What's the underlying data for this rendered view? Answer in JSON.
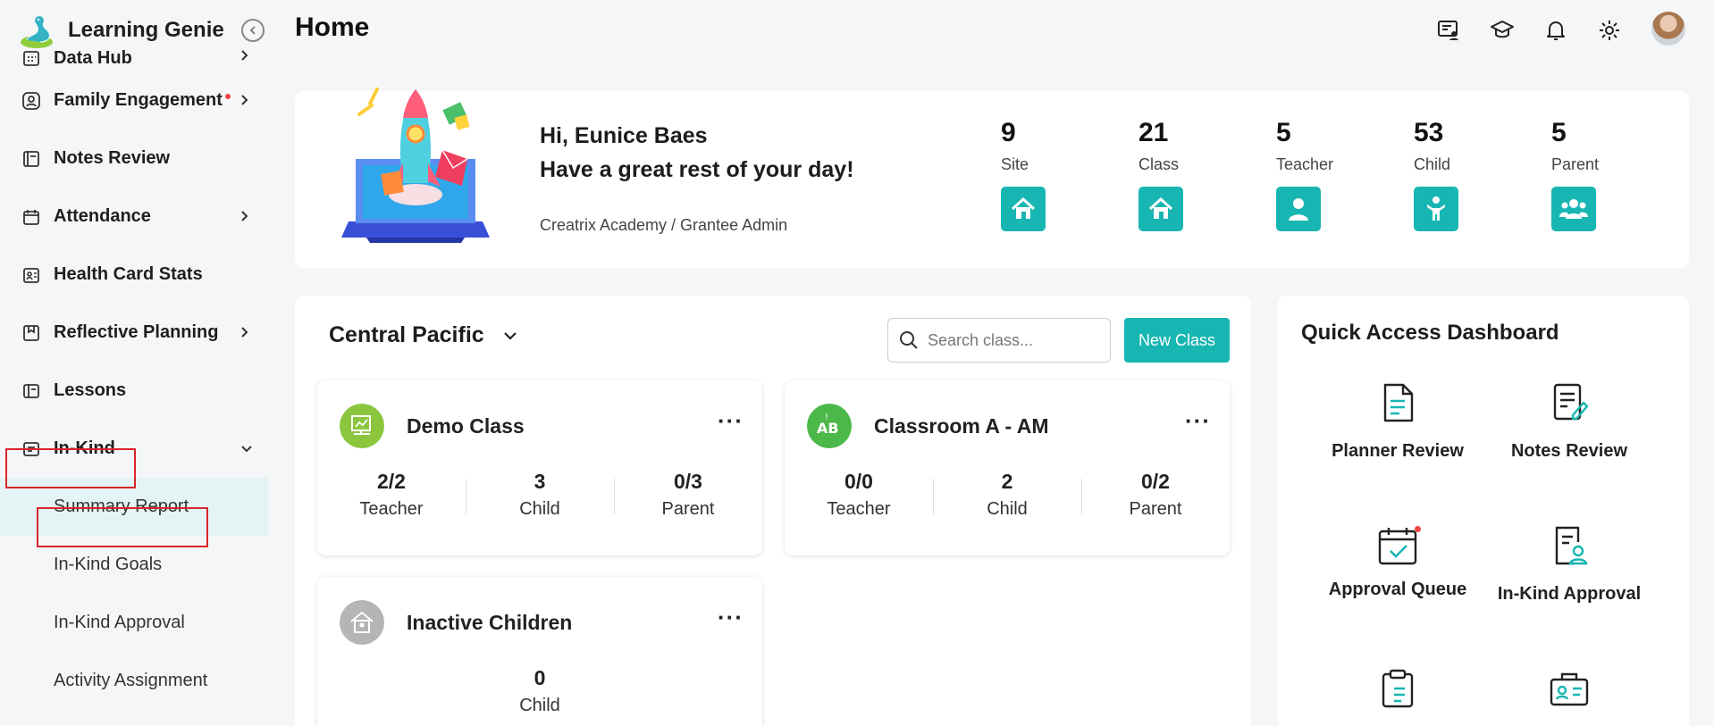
{
  "app": {
    "name": "Learning Genie"
  },
  "header": {
    "title": "Home"
  },
  "sidebar": {
    "items": [
      {
        "label": "Data Hub",
        "icon": "calendar-grid-icon"
      },
      {
        "label": "Family Engagement",
        "icon": "family-icon",
        "has_notification": true
      },
      {
        "label": "Notes Review",
        "icon": "notes-icon"
      },
      {
        "label": "Attendance",
        "icon": "calendar-icon"
      },
      {
        "label": "Health Card Stats",
        "icon": "health-card-icon"
      },
      {
        "label": "Reflective Planning",
        "icon": "bookmark-icon"
      },
      {
        "label": "Lessons",
        "icon": "book-icon"
      },
      {
        "label": "In-Kind",
        "icon": "inkind-icon"
      }
    ],
    "inkind_sub": [
      {
        "label": "Summary Report",
        "active": true
      },
      {
        "label": "In-Kind Goals"
      },
      {
        "label": "In-Kind Approval"
      },
      {
        "label": "Activity Assignment"
      }
    ]
  },
  "welcome": {
    "greeting": "Hi, Eunice Baes",
    "message": "Have a great rest of your day!",
    "org": "Creatrix Academy / Grantee Admin"
  },
  "stats": [
    {
      "value": "9",
      "label": "Site",
      "icon": "home-icon"
    },
    {
      "value": "21",
      "label": "Class",
      "icon": "home-icon"
    },
    {
      "value": "5",
      "label": "Teacher",
      "icon": "person-icon"
    },
    {
      "value": "53",
      "label": "Child",
      "icon": "child-icon"
    },
    {
      "value": "5",
      "label": "Parent",
      "icon": "group-icon"
    }
  ],
  "classes_panel": {
    "region": "Central Pacific",
    "search_placeholder": "Search class...",
    "new_class_label": "New Class",
    "more_label": "···",
    "cards": [
      {
        "name": "Demo Class",
        "stats": [
          {
            "value": "2/2",
            "label": "Teacher"
          },
          {
            "value": "3",
            "label": "Child"
          },
          {
            "value": "0/3",
            "label": "Parent"
          }
        ]
      },
      {
        "name": "Classroom A - AM",
        "stats": [
          {
            "value": "0/0",
            "label": "Teacher"
          },
          {
            "value": "2",
            "label": "Child"
          },
          {
            "value": "0/2",
            "label": "Parent"
          }
        ]
      },
      {
        "name": "Inactive Children",
        "stats": [
          {
            "value": "0",
            "label": "Child"
          }
        ]
      }
    ]
  },
  "quick_access": {
    "title": "Quick Access Dashboard",
    "items": [
      {
        "label": "Planner Review",
        "icon": "document-icon"
      },
      {
        "label": "Notes Review",
        "icon": "edit-notes-icon"
      },
      {
        "label": "Approval Queue",
        "icon": "calendar-check-icon",
        "has_notification": true
      },
      {
        "label": "In-Kind Approval",
        "icon": "user-document-icon"
      },
      {
        "label": "",
        "icon": "clipboard-icon"
      },
      {
        "label": "",
        "icon": "briefcase-id-icon"
      }
    ]
  },
  "colors": {
    "accent": "#18b6b2",
    "highlight_border": "#d9252b",
    "active_bg": "#e4f4f5",
    "notification": "#ef4444"
  }
}
